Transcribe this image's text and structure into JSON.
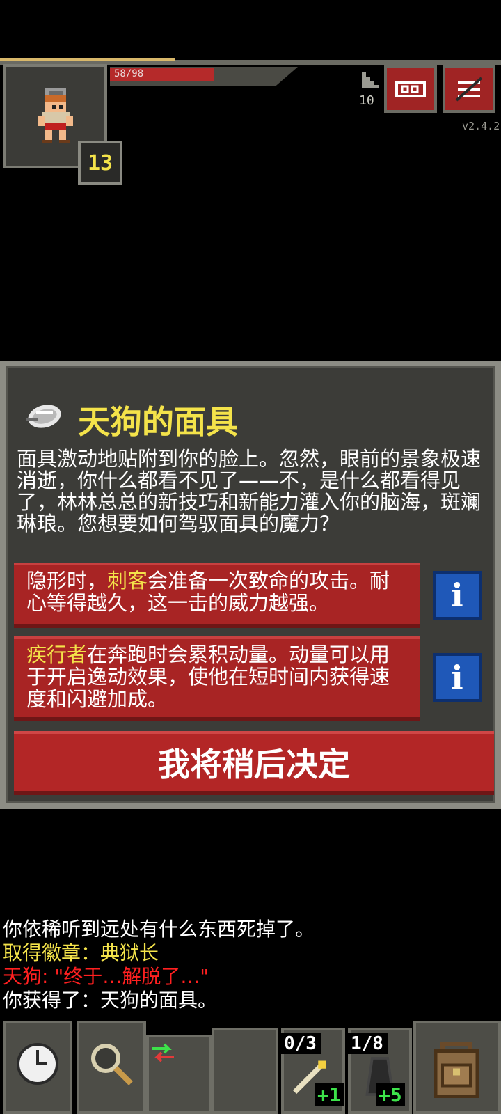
{
  "hud": {
    "hp_text": "58/98",
    "hp_fraction": 0.59,
    "exp_fraction": 0.35,
    "level": "13",
    "depth": "10",
    "version": "v2.4.2"
  },
  "dialog": {
    "title": "天狗的面具",
    "description": "面具激动地贴附到你的脸上。忽然，眼前的景象极速消逝，你什么都看不见了——不，是什么都看得见了，林林总总的新技巧和新能力灌入你的脑海，斑斓琳琅。您想要如何驾驭面具的魔力？",
    "choice1": {
      "pre": "隐形时，",
      "highlight": "刺客",
      "post": "会准备一次致命的攻击。耐心等得越久，这一击的威力越强。"
    },
    "choice2": {
      "pre": "",
      "highlight": "疾行者",
      "post": "在奔跑时会累积动量。动量可以用于开启逸动效果，使他在短时间内获得速度和闪避加成。"
    },
    "info_label": "i",
    "later_label": "我将稍后决定"
  },
  "log": [
    {
      "text": "你依稀听到远处有什么东西死掉了。",
      "color": "white"
    },
    {
      "text": "取得徽章：典狱长",
      "color": "yellow"
    },
    {
      "text": "天狗: \"终于…解脱了…\"",
      "color": "red"
    },
    {
      "text": "你获得了：天狗的面具。",
      "color": "white"
    }
  ],
  "toolbar": {
    "slot2_count": "0/3",
    "slot2_bonus": "+1",
    "slot3_count": "1/8",
    "slot3_bonus": "+5"
  },
  "colors": {
    "hp": "#b52a2a",
    "title": "#f4e34a",
    "button_red": "#a82424",
    "info_blue": "#1f58b8"
  }
}
